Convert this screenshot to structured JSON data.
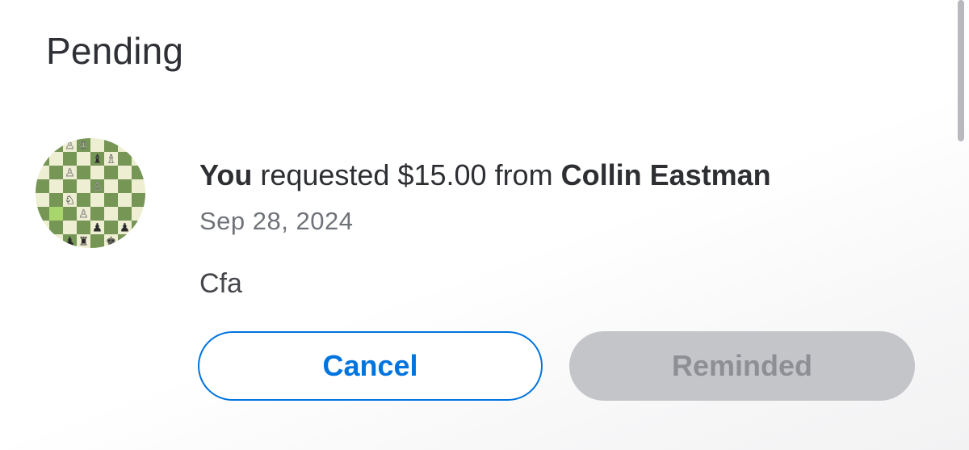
{
  "section": {
    "title": "Pending"
  },
  "request": {
    "actor": "You",
    "verb_amount": " requested $15.00 from ",
    "counterparty": "Collin Eastman",
    "date": "Sep 28, 2024",
    "note": "Cfa",
    "avatar": {
      "icon": "chessboard-avatar-icon",
      "light_square": "#eeeed2",
      "dark_square": "#769656"
    }
  },
  "actions": {
    "cancel_label": "Cancel",
    "reminded_label": "Reminded"
  },
  "colors": {
    "accent": "#0074de",
    "disabled_bg": "#c4c5c9",
    "disabled_text": "#8d8f95"
  }
}
